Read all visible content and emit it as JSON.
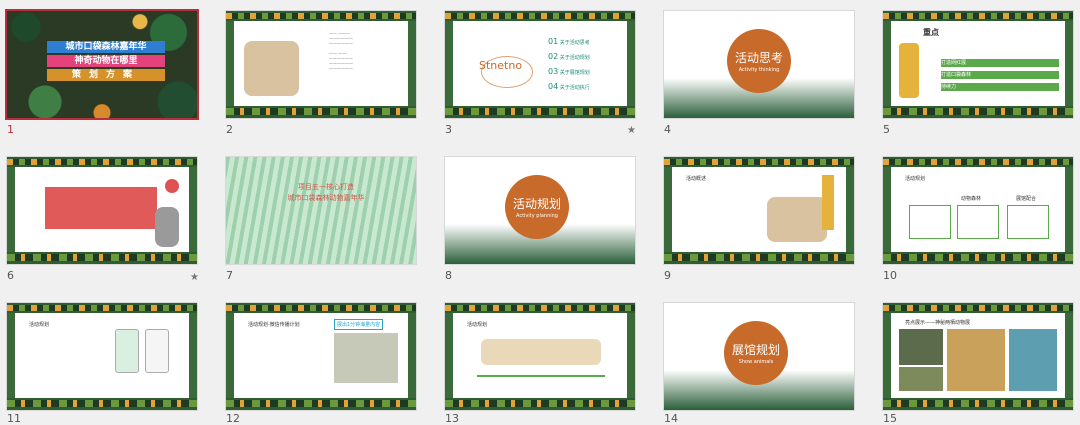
{
  "slides": [
    {
      "number": "1",
      "title_lines": [
        "城市口袋森林嘉年华",
        "神奇动物在哪里",
        "策划方案"
      ],
      "selected": true
    },
    {
      "number": "2"
    },
    {
      "number": "3",
      "brand": "Stnetno",
      "items": [
        {
          "n": "01",
          "label": "关于活动思考"
        },
        {
          "n": "02",
          "label": "关于活动规划"
        },
        {
          "n": "03",
          "label": "关于展馆规划"
        },
        {
          "n": "04",
          "label": "关于活动执行"
        }
      ],
      "star": "★"
    },
    {
      "number": "4",
      "title": "活动思考",
      "subtitle": "Activity thinking"
    },
    {
      "number": "5",
      "heading": "重点",
      "rows": [
        "打造网红展",
        "打造口袋森林",
        "持续力"
      ]
    },
    {
      "number": "6",
      "star": "★"
    },
    {
      "number": "7",
      "headline": "项目五一核心打造",
      "sub": "城市口袋森林动物嘉年华"
    },
    {
      "number": "8",
      "title": "活动规划",
      "subtitle": "Activity planning"
    },
    {
      "number": "9",
      "heading": "活动概述"
    },
    {
      "number": "10",
      "heading": "活动规划",
      "cols": [
        "动物森林",
        "展馆配合"
      ]
    },
    {
      "number": "11",
      "heading": "活动规划"
    },
    {
      "number": "12",
      "heading": "活动规划·微信传播计划",
      "tag": "展出1分钟海量内容"
    },
    {
      "number": "13",
      "heading": "活动规划"
    },
    {
      "number": "14",
      "title": "展馆规划",
      "subtitle": "Show animals"
    },
    {
      "number": "15",
      "heading": "亮点展示——神秘两栖动物展"
    }
  ],
  "bottom_numbers": [
    "11",
    "12",
    "13",
    "14",
    "15"
  ],
  "colors": {
    "accent": "#c76a2a",
    "selection": "#b5303a",
    "pink": "#e3427a"
  }
}
